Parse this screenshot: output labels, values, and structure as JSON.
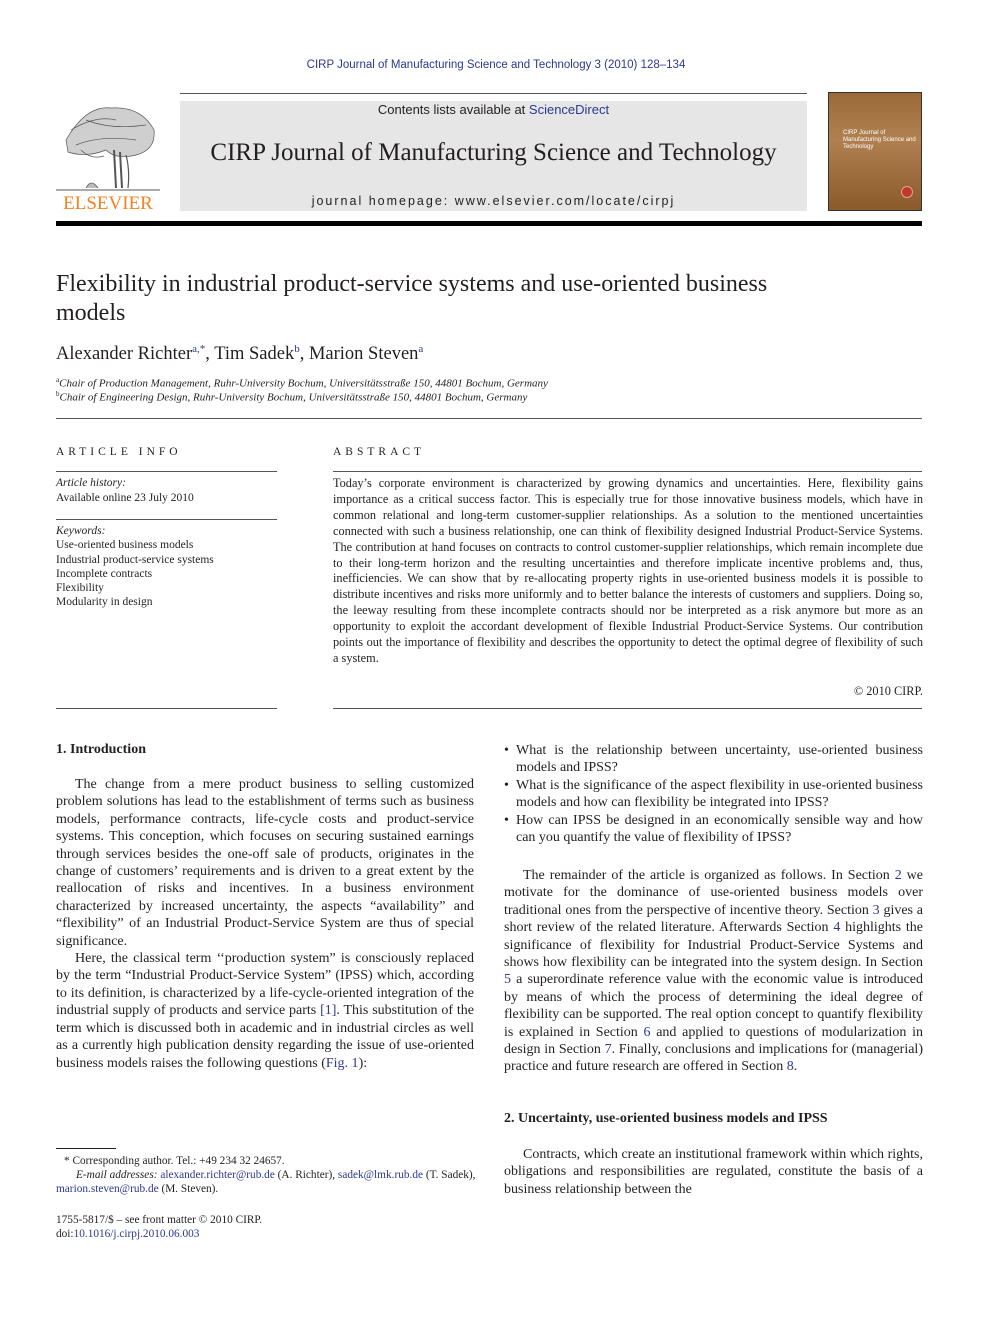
{
  "running_head": "CIRP Journal of Manufacturing Science and Technology 3 (2010) 128–134",
  "masthead": {
    "publisher_logo": "ELSEVIER",
    "contents_prefix": "Contents lists available at ",
    "contents_link": "ScienceDirect",
    "journal_title": "CIRP Journal of Manufacturing Science and Technology",
    "homepage": "journal homepage: www.elsevier.com/locate/cirpj",
    "cover_text": "CIRP Journal of Manufacturing Science and Technology",
    "brand_color": "#f58220",
    "link_color": "#2b3990"
  },
  "article": {
    "title": "Flexibility in industrial product-service systems and use-oriented business models",
    "authors": [
      {
        "name": "Alexander Richter",
        "sup": "a,*"
      },
      {
        "name": "Tim Sadek",
        "sup": "b"
      },
      {
        "name": "Marion Steven",
        "sup": "a"
      }
    ],
    "affiliations": [
      {
        "sup": "a",
        "text": "Chair of Production Management, Ruhr-University Bochum, Universitätsstraße 150, 44801 Bochum, Germany"
      },
      {
        "sup": "b",
        "text": "Chair of Engineering Design, Ruhr-University Bochum, Universitätsstraße 150, 44801 Bochum, Germany"
      }
    ]
  },
  "article_info": {
    "heading": "ARTICLE INFO",
    "history_label": "Article history:",
    "history_value": "Available online 23 July 2010",
    "keywords_label": "Keywords:",
    "keywords": [
      "Use-oriented business models",
      "Industrial product-service systems",
      "Incomplete contracts",
      "Flexibility",
      "Modularity in design"
    ]
  },
  "abstract": {
    "heading": "ABSTRACT",
    "text": "Today’s corporate environment is characterized by growing dynamics and uncertainties. Here, flexibility gains importance as a critical success factor. This is especially true for those innovative business models, which have in common relational and long-term customer-supplier relationships. As a solution to the mentioned uncertainties connected with such a business relationship, one can think of flexibility designed Industrial Product-Service Systems. The contribution at hand focuses on contracts to control customer-supplier relationships, which remain incomplete due to their long-term horizon and the resulting uncertainties and therefore implicate incentive problems and, thus, inefficiencies. We can show that by re-allocating property rights in use-oriented business models it is possible to distribute incentives and risks more uniformly and to better balance the interests of customers and suppliers. Doing so, the leeway resulting from these incomplete contracts should nor be interpreted as a risk anymore but more as an opportunity to exploit the accordant development of flexible Industrial Product-Service Systems. Our contribution points out the importance of flexibility and describes the opportunity to detect the optimal degree of flexibility of such a system.",
    "copyright": "© 2010 CIRP."
  },
  "section1": {
    "heading": "1.  Introduction",
    "para1": "The change from a mere product business to selling customized problem solutions has lead to the establishment of terms such as business models, performance contracts, life-cycle costs and product-service systems. This conception, which focuses on securing sustained earnings through services besides the one-off sale of products, originates in the change of customers’ requirements and is driven to a great extent by the reallocation of risks and incentives. In a business environment characterized by increased uncertainty, the aspects “availability” and “flexibility” of an Industrial Product-Service System are thus of special significance.",
    "para2_a": "Here, the classical term ‘‘production system” is consciously replaced by the term “Industrial Product-Service System” (IPSS) which, according to its definition, is characterized by a life-cycle-oriented integration of the industrial supply of products and service parts ",
    "para2_ref": "[1]",
    "para2_b": ". This substitution of the term which is discussed both in academic and in industrial circles as well as a currently high publication density regarding the issue of use-oriented business models raises the following questions (",
    "para2_fig": "Fig. 1",
    "para2_c": "):",
    "questions": [
      "What is the relationship between uncertainty, use-oriented business models and IPSS?",
      "What is the significance of the aspect flexibility in use-oriented business models and how can flexibility be integrated into IPSS?",
      "How can IPSS be designed in an economically sensible way and how can you quantify the value of flexibility of IPSS?"
    ],
    "remainder": {
      "t1": "The remainder of the article is organized as follows. In Section ",
      "s2": "2",
      "t2": " we motivate for the dominance of use-oriented business models over traditional ones from the perspective of incentive theory. Section ",
      "s3": "3",
      "t3": " gives a short review of the related literature. Afterwards Section ",
      "s4": "4",
      "t4": " highlights the significance of flexibility for Industrial Product-Service Systems and shows how flexibility can be integrated into the system design. In Section ",
      "s5": "5",
      "t5": " a superordinate reference value with the economic value is introduced by means of which the process of determining the ideal degree of flexibility can be supported. The real option concept to quantify flexibility is explained in Section ",
      "s6": "6",
      "t6": " and applied to questions of modularization in design in Section ",
      "s7": "7",
      "t7": ". Finally, conclusions and implications for (managerial) practice and future research are offered in Section ",
      "s8": "8",
      "t8": "."
    }
  },
  "section2": {
    "heading": "2.  Uncertainty, use-oriented business models and IPSS",
    "para1": "Contracts, which create an institutional framework within which rights, obligations and responsibilities are regulated, constitute the basis of a business relationship between the"
  },
  "footnotes": {
    "corresponding": "* Corresponding author. Tel.: +49 234 32 24657.",
    "email_label": "E-mail addresses:",
    "emails": [
      {
        "address": "alexander.richter@rub.de",
        "who": "(A. Richter)"
      },
      {
        "address": "sadek@lmk.rub.de",
        "who": "(T. Sadek)"
      },
      {
        "address": "marion.steven@rub.de",
        "who": "(M. Steven)."
      }
    ],
    "issn": "1755-5817/$ – see front matter © 2010 CIRP.",
    "doi_prefix": "doi:",
    "doi": "10.1016/j.cirpj.2010.06.003"
  }
}
